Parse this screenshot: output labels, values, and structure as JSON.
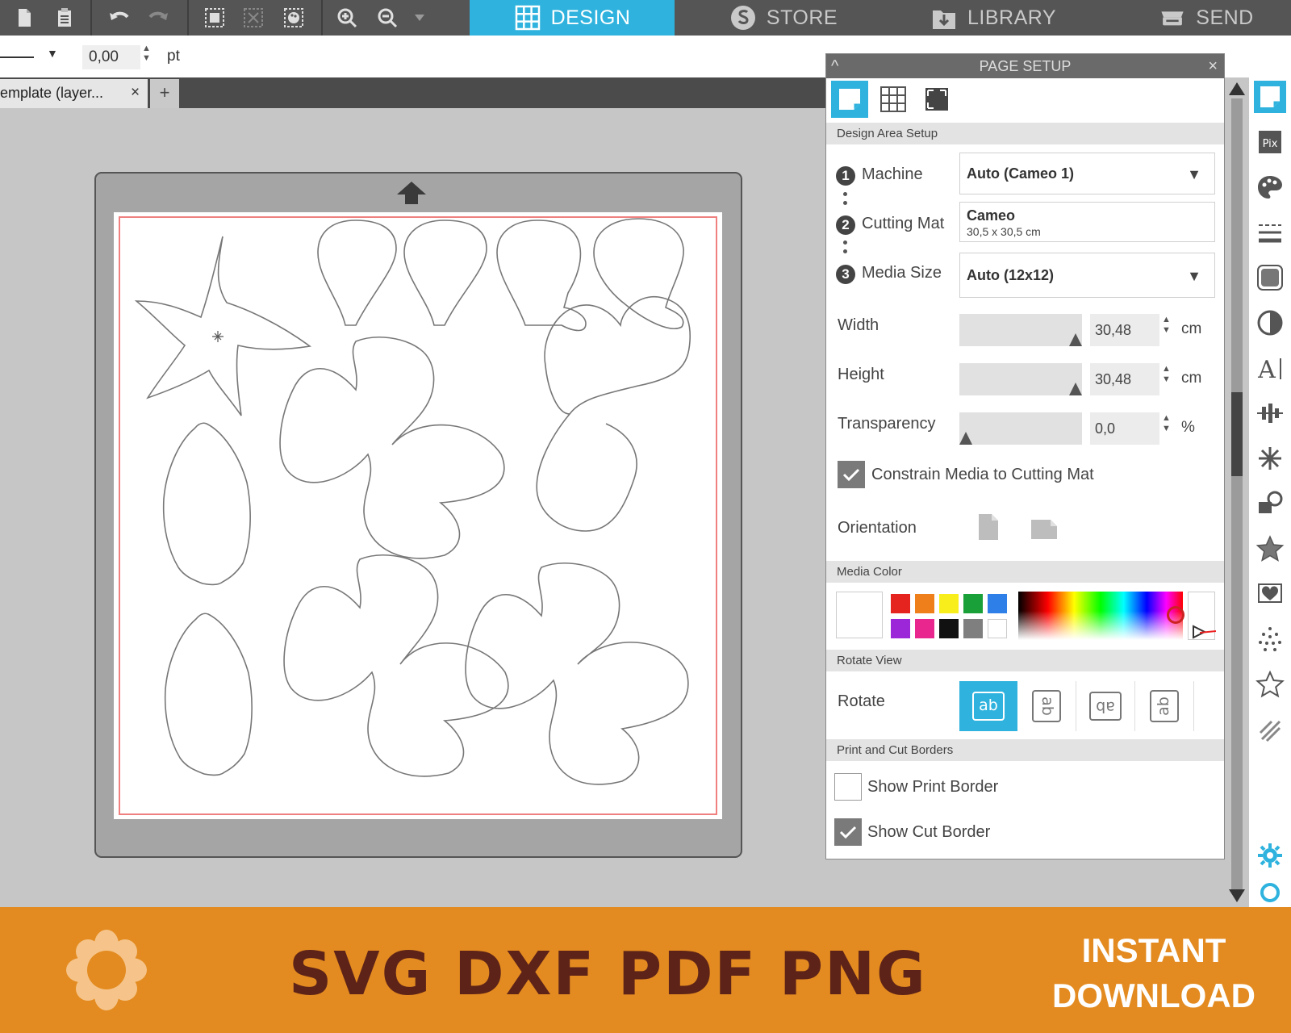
{
  "nav": {
    "tabs": [
      {
        "label": "DESIGN",
        "icon": "grid-icon"
      },
      {
        "label": "STORE",
        "icon": "store-s-icon"
      },
      {
        "label": "LIBRARY",
        "icon": "library-icon"
      },
      {
        "label": "SEND",
        "icon": "send-machine-icon"
      }
    ]
  },
  "subbar": {
    "stroke_value": "0,00",
    "stroke_unit": "pt"
  },
  "document": {
    "tab_label": "emplate (layer...",
    "close": "×",
    "add": "+"
  },
  "panel": {
    "title": "PAGE SETUP",
    "collapse": "^",
    "close": "×",
    "design_area_header": "Design Area Setup",
    "machine": {
      "num": "1",
      "label": "Machine",
      "value": "Auto (Cameo 1)"
    },
    "cutting_mat": {
      "num": "2",
      "label": "Cutting Mat",
      "value": "Cameo",
      "sub": "30,5 x 30,5 cm"
    },
    "media_size": {
      "num": "3",
      "label": "Media Size",
      "value": "Auto (12x12)"
    },
    "width": {
      "label": "Width",
      "value": "30,48",
      "unit": "cm"
    },
    "height": {
      "label": "Height",
      "value": "30,48",
      "unit": "cm"
    },
    "transparency": {
      "label": "Transparency",
      "value": "0,0",
      "unit": "%",
      "level": 0
    },
    "constrain_label": "Constrain Media to Cutting Mat",
    "constrain_checked": true,
    "orientation_label": "Orientation",
    "media_color_header": "Media Color",
    "swatches": [
      "#e52420",
      "#ee7f1b",
      "#f7ee1c",
      "#19a038",
      "#2f7fe8",
      "#9c27d8",
      "#e8268d",
      "#111111",
      "#7f7f7f",
      "#ffffff"
    ],
    "rotate_view_header": "Rotate View",
    "rotate_label": "Rotate",
    "rotate_glyphs": [
      "ab",
      "ab",
      "ab",
      "ab"
    ],
    "print_cut_header": "Print and Cut Borders",
    "show_print_border": "Show Print Border",
    "show_print_border_checked": false,
    "show_cut_border": "Show Cut Border",
    "show_cut_border_checked": true
  },
  "banner": {
    "formats": "SVG DXF PDF PNG",
    "line1": "INSTANT",
    "line2": "DOWNLOAD",
    "accent": "#e38b20",
    "text_color": "#5e2318"
  },
  "colors": {
    "accent": "#2fb3de",
    "toolbar": "#555555",
    "cut_border": "#f08080"
  }
}
